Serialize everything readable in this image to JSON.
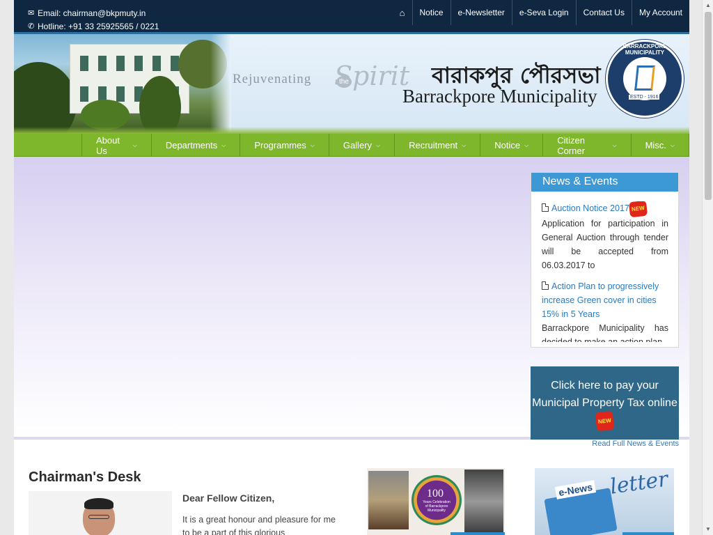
{
  "topbar": {
    "email": "Email: chairman@bkpmuty.in",
    "hotline": "Hotline: +91 33 25925565 / 0221",
    "links": [
      "Notice",
      "e-Newsletter",
      "e-Seva Login",
      "Contact Us",
      "My Account"
    ]
  },
  "banner": {
    "tagline": "Rejuvenating",
    "tagline_the": "the",
    "tagline_spirit": "Spirit",
    "title_bengali": "বারাকপুর পৌরসভা",
    "title_english": "Barrackpore Municipality",
    "seal_text": "BARRACKPORE MUNICIPALITY",
    "seal_estd": "ESTD - 1916"
  },
  "mainnav": [
    "About Us",
    "Departments",
    "Programmes",
    "Gallery",
    "Recruitment",
    "Notice",
    "Citizen Corner",
    "Misc."
  ],
  "news": {
    "heading": "News & Events",
    "items": [
      {
        "title": "Auction Notice 2017",
        "badge": "NEW",
        "desc": "Application for participation in General Auction through tender will be accepted from 06.03.2017 to"
      },
      {
        "title": "Action Plan to progressively increase Green cover in cities 15% in 5 Years",
        "desc": "Barrackpore Municipality has decided to make an action plan"
      }
    ],
    "read_full": "Read Full News & Events"
  },
  "tax": {
    "text": "Click here to pay your Municipal Property Tax online",
    "badge": "NEW"
  },
  "chairman": {
    "title": "Chairman's Desk",
    "greeting": "Dear Fellow Citizen,",
    "text": "It is a great honour and pleasure for me to be a part of this glorious"
  },
  "thumbs": {
    "centenary_number": "100",
    "centenary_sub": "Years Celebration of Barrackpore Municipality",
    "enews_label": "e-News",
    "enews_big": "letter"
  },
  "colors": {
    "topbar": "#0f2741",
    "nav_green": "#7eb72c",
    "news_head": "#3d99d6",
    "tax_box": "#2e6787",
    "link": "#2a7ac0"
  }
}
